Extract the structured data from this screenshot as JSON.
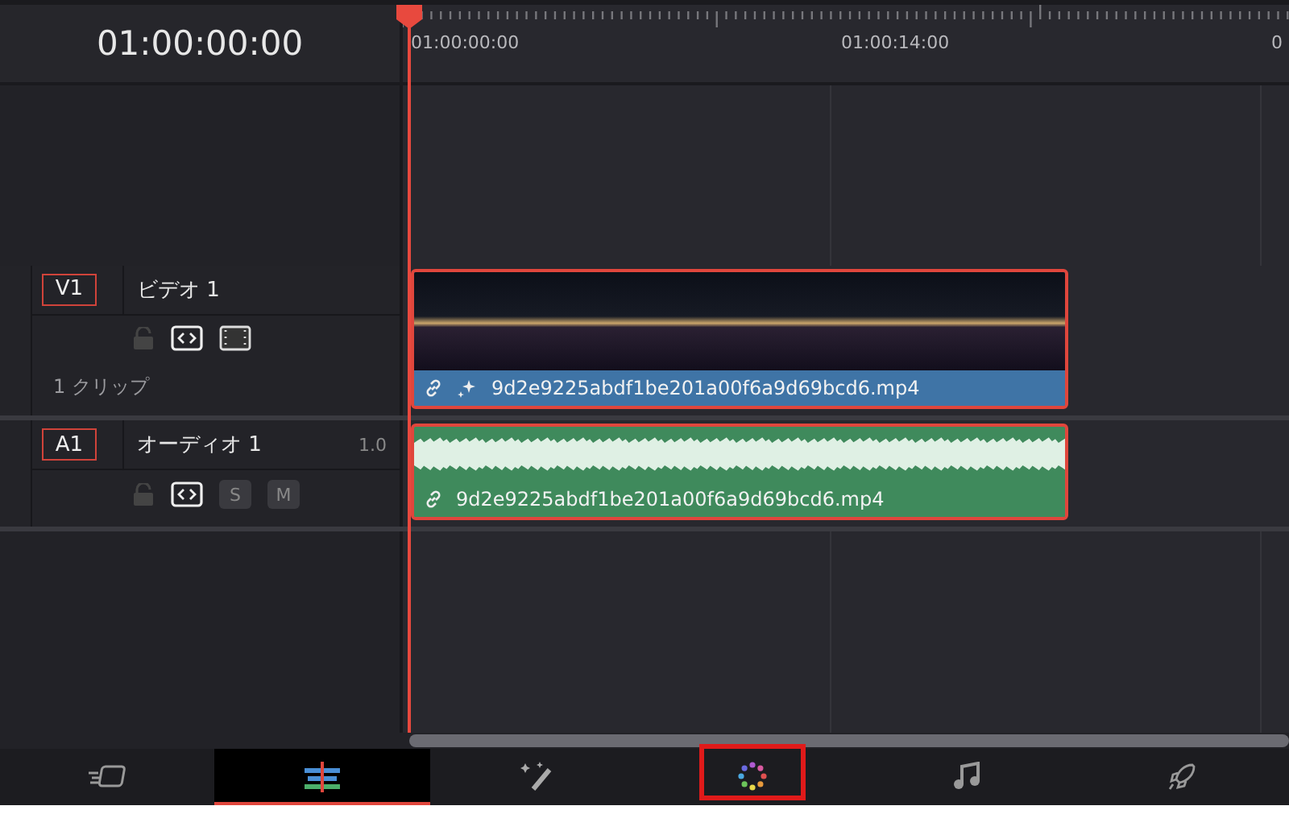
{
  "timecode": "01:00:00:00",
  "ruler": {
    "labels": [
      "01:00:00:00",
      "01:00:14:00",
      "0"
    ]
  },
  "tracks": [
    {
      "kind": "video",
      "tag": "V1",
      "name": "ビデオ 1",
      "info": "1 クリップ",
      "selected": true,
      "clip": {
        "name": "9d2e9225abdf1be201a00f6a9d69bcd6.mp4",
        "selected": true
      }
    },
    {
      "kind": "audio",
      "tag": "A1",
      "name": "オーディオ 1",
      "volume": "1.0",
      "solo": "S",
      "mute": "M",
      "selected": true,
      "clip": {
        "name": "9d2e9225abdf1be201a00f6a9d69bcd6.mp4",
        "selected": true
      }
    }
  ],
  "pages": [
    {
      "kind": "media",
      "selected": false,
      "highlighted": false
    },
    {
      "kind": "edit",
      "selected": true,
      "highlighted": false
    },
    {
      "kind": "fusion",
      "selected": false,
      "highlighted": false
    },
    {
      "kind": "color",
      "selected": false,
      "highlighted": true
    },
    {
      "kind": "audio",
      "selected": false,
      "highlighted": false
    },
    {
      "kind": "deliver",
      "selected": false,
      "highlighted": false
    }
  ]
}
